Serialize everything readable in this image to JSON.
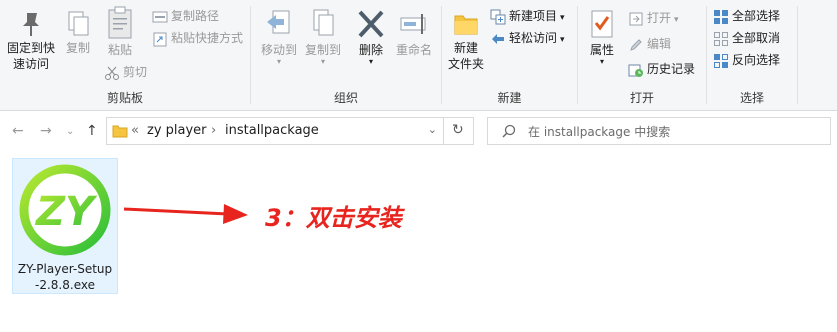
{
  "ribbon": {
    "clipboard": {
      "label": "剪贴板",
      "pin_label_1": "固定到快",
      "pin_label_2": "速访问",
      "copy_label": "复制",
      "paste_label": "粘贴",
      "copy_path_label": "复制路径",
      "paste_shortcut_label": "粘贴快捷方式",
      "cut_label": "剪切"
    },
    "organize": {
      "label": "组织",
      "move_to_label": "移动到",
      "copy_to_label": "复制到",
      "delete_label": "删除",
      "rename_label": "重命名"
    },
    "new": {
      "label": "新建",
      "new_folder_label_1": "新建",
      "new_folder_label_2": "文件夹",
      "new_item_label": "新建项目",
      "easy_access_label": "轻松访问"
    },
    "open": {
      "label": "打开",
      "properties_label": "属性",
      "open_label": "打开",
      "edit_label": "编辑",
      "history_label": "历史记录"
    },
    "select": {
      "label": "选择",
      "select_all_label": "全部选择",
      "select_none_label": "全部取消",
      "invert_label": "反向选择"
    }
  },
  "address": {
    "crumb_overflow": "«",
    "crumb_1": "zy player",
    "separator": "›",
    "crumb_2": "installpackage",
    "search_placeholder": "在 installpackage 中搜索"
  },
  "files": [
    {
      "name_line_1": "ZY-Player-Setup",
      "name_line_2": "-2.8.8.exe",
      "logo_text": "ZY"
    }
  ],
  "annotation": {
    "text": "3：双击安装"
  },
  "colors": {
    "accent": "#0078d7",
    "annotation": "#e8241e",
    "selection": "#e5f3ff",
    "logo_green": "#7ed321"
  }
}
